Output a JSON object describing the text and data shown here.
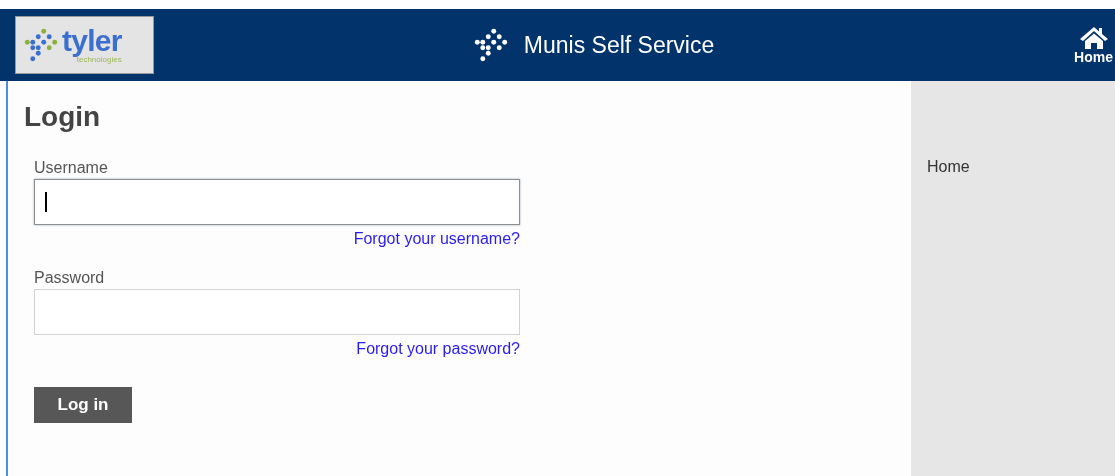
{
  "header": {
    "logo": {
      "name": "tyler",
      "tagline": "technologies"
    },
    "title": "Munis Self Service",
    "home": {
      "label": "Home"
    }
  },
  "login": {
    "title": "Login",
    "fields": [
      {
        "label": "Username",
        "focused": true,
        "link": "Forgot your username?"
      },
      {
        "label": "Password",
        "focused": false,
        "link": "Forgot your password?"
      }
    ],
    "button": "Log in"
  },
  "sidebar": {
    "items": [
      {
        "label": "Home"
      }
    ]
  }
}
